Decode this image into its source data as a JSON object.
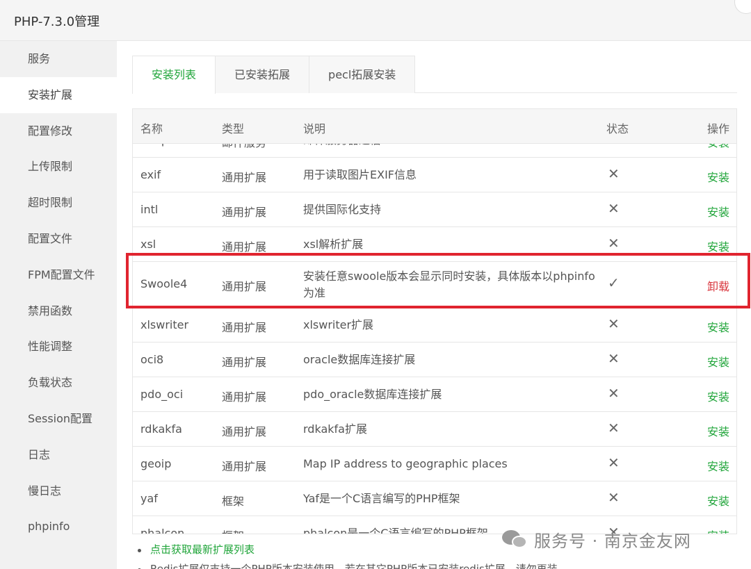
{
  "window": {
    "title": "PHP-7.3.0管理"
  },
  "sidebar": {
    "items": [
      {
        "label": "服务",
        "active": false
      },
      {
        "label": "安装扩展",
        "active": true
      },
      {
        "label": "配置修改",
        "active": false
      },
      {
        "label": "上传限制",
        "active": false
      },
      {
        "label": "超时限制",
        "active": false
      },
      {
        "label": "配置文件",
        "active": false
      },
      {
        "label": "FPM配置文件",
        "active": false
      },
      {
        "label": "禁用函数",
        "active": false
      },
      {
        "label": "性能调整",
        "active": false
      },
      {
        "label": "负载状态",
        "active": false
      },
      {
        "label": "Session配置",
        "active": false
      },
      {
        "label": "日志",
        "active": false
      },
      {
        "label": "慢日志",
        "active": false
      },
      {
        "label": "phpinfo",
        "active": false
      }
    ]
  },
  "tabs": [
    {
      "label": "安装列表",
      "active": true
    },
    {
      "label": "已安装拓展",
      "active": false
    },
    {
      "label": "pecl拓展安装",
      "active": false
    }
  ],
  "table": {
    "headers": {
      "name": "名称",
      "type": "类型",
      "desc": "说明",
      "status": "状态",
      "op": "操作"
    },
    "partial_top": {
      "name": "imap",
      "type": "邮件服务",
      "desc": "邮件服务器通信",
      "status": "✓",
      "op": "安装"
    },
    "rows": [
      {
        "name": "exif",
        "type": "通用扩展",
        "desc": "用于读取图片EXIF信息",
        "status": "✕",
        "op": "安装",
        "op_style": "install"
      },
      {
        "name": "intl",
        "type": "通用扩展",
        "desc": "提供国际化支持",
        "status": "✕",
        "op": "安装",
        "op_style": "install"
      },
      {
        "name": "xsl",
        "type": "通用扩展",
        "desc": "xsl解析扩展",
        "status": "✕",
        "op": "安装",
        "op_style": "install"
      },
      {
        "name": "Swoole4",
        "type": "通用扩展",
        "desc": "安装任意swoole版本会显示同时安装，具体版本以phpinfo为准",
        "status": "✓",
        "op": "卸载",
        "op_style": "uninstall"
      },
      {
        "name": "xlswriter",
        "type": "通用扩展",
        "desc": "xlswriter扩展",
        "status": "✕",
        "op": "安装",
        "op_style": "install"
      },
      {
        "name": "oci8",
        "type": "通用扩展",
        "desc": "oracle数据库连接扩展",
        "status": "✕",
        "op": "安装",
        "op_style": "install"
      },
      {
        "name": "pdo_oci",
        "type": "通用扩展",
        "desc": "pdo_oracle数据库连接扩展",
        "status": "✕",
        "op": "安装",
        "op_style": "install"
      },
      {
        "name": "rdkakfa",
        "type": "通用扩展",
        "desc": "rdkakfa扩展",
        "status": "✕",
        "op": "安装",
        "op_style": "install"
      },
      {
        "name": "geoip",
        "type": "通用扩展",
        "desc": "Map IP address to geographic places",
        "status": "✕",
        "op": "安装",
        "op_style": "install"
      },
      {
        "name": "yaf",
        "type": "框架",
        "desc": "Yaf是一个C语言编写的PHP框架",
        "status": "✕",
        "op": "安装",
        "op_style": "install"
      },
      {
        "name": "phalcon",
        "type": "框架",
        "desc": "phalcon是一个C语言编写的PHP框架",
        "status": "✕",
        "op": "安装",
        "op_style": "install"
      }
    ]
  },
  "notes": [
    {
      "text": "点击获取最新扩展列表",
      "link": true
    },
    {
      "text": "Redis扩展仅支持一个PHP版本安装使用，若在其它PHP版本已安装redis扩展，请勿再装",
      "link": false
    }
  ],
  "watermark": {
    "text": "服务号 · 南京金友网"
  },
  "colors": {
    "accent": "#20a53a",
    "danger": "#d9363e",
    "highlight": "#e0242f"
  }
}
